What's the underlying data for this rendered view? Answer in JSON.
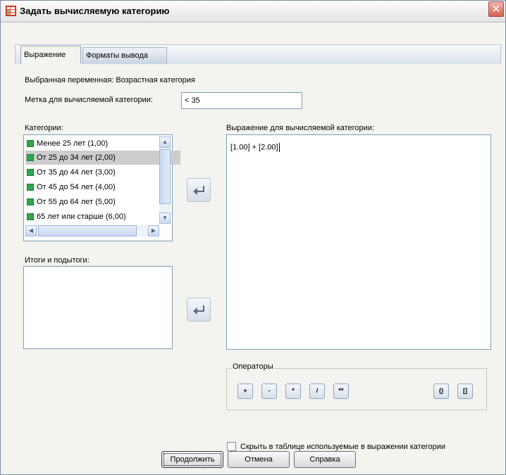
{
  "window": {
    "title": "Задать вычисляемую категорию",
    "close_glyph": "✕"
  },
  "tabs": [
    {
      "label": "Выражение",
      "active": true
    },
    {
      "label": "Форматы вывода",
      "active": false
    }
  ],
  "selected_variable": "Выбранная переменная: Возрастная категория",
  "label_field": {
    "label": "Метка для вычисляемой категории:",
    "value": "< 35"
  },
  "categories": {
    "label": "Категории:",
    "items": [
      {
        "label": "Менее 25 лет (1,00)",
        "selected": false
      },
      {
        "label": "От 25 до 34 лет (2,00)",
        "selected": true
      },
      {
        "label": "От 35 до 44 лет (3,00)",
        "selected": false
      },
      {
        "label": "От 45 до 54 лет (4,00)",
        "selected": false
      },
      {
        "label": "От 55 до 64 лет (5,00)",
        "selected": false
      },
      {
        "label": "65 лет или старше (6,00)",
        "selected": false
      }
    ]
  },
  "totals": {
    "label": "Итоги и подытоги:"
  },
  "expression": {
    "label": "Выражение для вычисляемой категории:",
    "value": "[1.00] + [2.00]"
  },
  "operators": {
    "label": "Операторы",
    "buttons": [
      "+",
      "-",
      "*",
      "/",
      "**",
      "()",
      "[]"
    ]
  },
  "hide_checkbox": {
    "label": "Скрыть в таблице используемые в выражении категории",
    "checked": false
  },
  "buttons": {
    "continue": "Продолжить",
    "cancel": "Отмена",
    "help": "Справка"
  },
  "colors": {
    "category_icon": "#2fa74a",
    "close_button": "#d4614f",
    "arrow_icon": "#5c6b7d"
  }
}
